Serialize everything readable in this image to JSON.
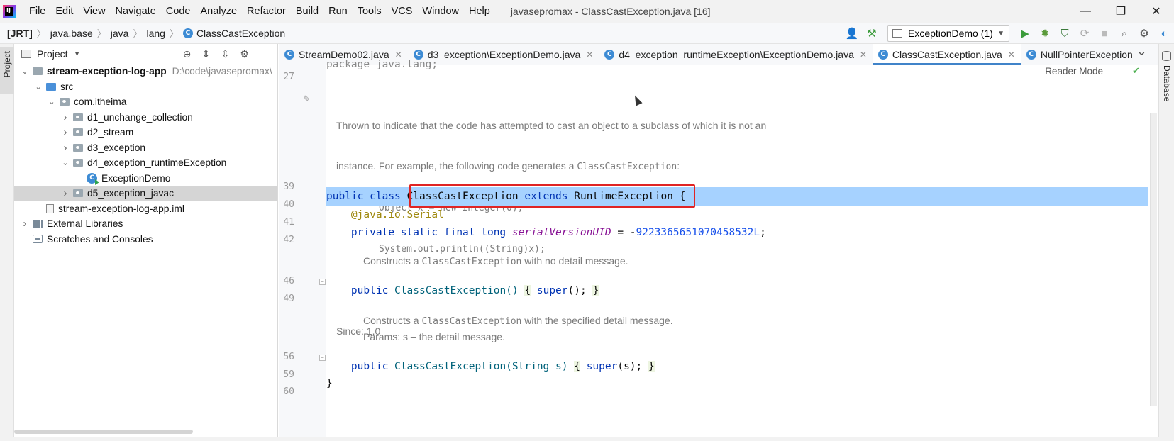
{
  "menubar": {
    "logo_text": "IJ",
    "items": [
      "File",
      "Edit",
      "View",
      "Navigate",
      "Code",
      "Analyze",
      "Refactor",
      "Build",
      "Run",
      "Tools",
      "VCS",
      "Window",
      "Help"
    ],
    "window_title": "javasepromax - ClassCastException.java [16]",
    "controls": [
      "—",
      "❐",
      "✕"
    ]
  },
  "navbar": {
    "breadcrumbs": [
      "[JRT]",
      "java.base",
      "java",
      "lang",
      "ClassCastException"
    ],
    "run_config": "ExceptionDemo (1)"
  },
  "left_strip": {
    "label": "Project"
  },
  "right_strip": {
    "label": "Database"
  },
  "project_panel": {
    "title": "Project",
    "tree": [
      {
        "label": "stream-exception-log-app",
        "path": "D:\\code\\javasepromax\\",
        "depth": 0,
        "expanded": true,
        "icon": "module-folder-icon",
        "bold": true
      },
      {
        "label": "src",
        "depth": 1,
        "expanded": true,
        "icon": "source-folder-icon"
      },
      {
        "label": "com.itheima",
        "depth": 2,
        "expanded": true,
        "icon": "package-icon"
      },
      {
        "label": "d1_unchange_collection",
        "depth": 3,
        "expanded": false,
        "icon": "package-icon"
      },
      {
        "label": "d2_stream",
        "depth": 3,
        "expanded": false,
        "icon": "package-icon"
      },
      {
        "label": "d3_exception",
        "depth": 3,
        "expanded": false,
        "icon": "package-icon"
      },
      {
        "label": "d4_exception_runtimeException",
        "depth": 3,
        "expanded": true,
        "icon": "package-icon"
      },
      {
        "label": "ExceptionDemo",
        "depth": 4,
        "leaf": true,
        "icon": "runnable-class-icon"
      },
      {
        "label": "d5_exception_javac",
        "depth": 3,
        "expanded": false,
        "icon": "package-icon",
        "selected": true
      },
      {
        "label": "stream-exception-log-app.iml",
        "depth": 1,
        "leaf": true,
        "icon": "iml-file-icon"
      },
      {
        "label": "External Libraries",
        "depth": 0,
        "expanded": false,
        "icon": "library-icon"
      },
      {
        "label": "Scratches and Consoles",
        "depth": 0,
        "leaf": true,
        "icon": "scratches-icon"
      }
    ]
  },
  "editor_tabs": [
    {
      "label": "StreamDemo02.java",
      "active": false
    },
    {
      "label": "d3_exception\\ExceptionDemo.java",
      "active": false
    },
    {
      "label": "d4_exception_runtimeException\\ExceptionDemo.java",
      "active": false
    },
    {
      "label": "ClassCastException.java",
      "active": true
    },
    {
      "label": "NullPointerException",
      "active": false
    }
  ],
  "editor": {
    "reader_mode": "Reader Mode",
    "top_partial": "package java.lang;",
    "line_numbers": [
      "27",
      "39",
      "40",
      "41",
      "42",
      "46",
      "49",
      "56",
      "59",
      "60"
    ],
    "doc1": {
      "line1": "Thrown to indicate that the code has attempted to cast an object to a subclass of which it is not an",
      "line2_prefix": "instance. For example, the following code generates a ",
      "line2_code": "ClassCastException",
      "line2_suffix": ":",
      "code1": "Object x = new Integer(0);",
      "code2": "System.out.println((String)x);",
      "since": "Since: 1.0"
    },
    "line39": {
      "kw1": "public",
      "kw2": "class",
      "name": "ClassCastException",
      "kw3": "extends",
      "parent": "RuntimeException",
      "brace": "{"
    },
    "line40": {
      "at": "@java.io.",
      "ann": "Serial"
    },
    "line41": {
      "mods": "private static final long",
      "field": "serialVersionUID",
      "eq": " = -",
      "value": "9223365651070458532L",
      "semi": ";"
    },
    "doc2": {
      "prefix": "Constructs a ",
      "code": "ClassCastException",
      "suffix": " with no detail message."
    },
    "line46": {
      "kw": "public",
      "name": "ClassCastException()",
      "open": "{",
      "body_kw": "super",
      "body_rest": "();",
      "close": "}"
    },
    "doc3": {
      "prefix": "Constructs a ",
      "code": "ClassCastException",
      "suffix": " with the specified detail message.",
      "params": "Params: s – the detail message."
    },
    "line56": {
      "kw": "public",
      "name": "ClassCastException(String s)",
      "open": "{",
      "body_kw": "super",
      "body_rest": "(s);",
      "close": "}"
    },
    "line59": "}"
  }
}
